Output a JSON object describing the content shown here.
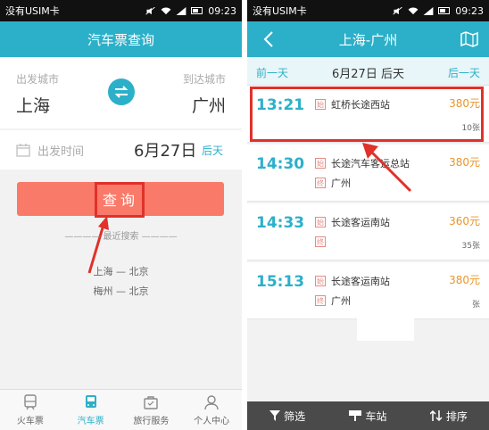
{
  "left": {
    "status": {
      "carrier": "没有USIM卡",
      "time": "09:23"
    },
    "title": "汽车票查询",
    "from_label": "出发城市",
    "to_label": "到达城市",
    "from_city": "上海",
    "to_city": "广州",
    "date_label": "出发时间",
    "date_value": "6月27日",
    "date_day": "后天",
    "query_button": "查询",
    "recent_title": "———— 最近搜索 ————",
    "recent": [
      "上海 — 北京",
      "梅州 — 北京"
    ],
    "tabs": [
      {
        "label": "火车票",
        "icon": "train-icon"
      },
      {
        "label": "汽车票",
        "icon": "bus-icon"
      },
      {
        "label": "旅行服务",
        "icon": "bag-icon"
      },
      {
        "label": "个人中心",
        "icon": "person-icon"
      }
    ],
    "accent": "#2cb0c9",
    "button_color": "#fa7a6a",
    "highlight_color": "#e0312a"
  },
  "right": {
    "status": {
      "carrier": "没有USIM卡",
      "time": "09:23"
    },
    "title": "上海-广州",
    "prev_day": "前一天",
    "current_day": "6月27日  后天",
    "next_day": "后一天",
    "start_tag": "始",
    "end_tag": "终",
    "trips": [
      {
        "time": "13:21",
        "from": "虹桥长途西站",
        "to": "",
        "price": "380元",
        "seats": "10张"
      },
      {
        "time": "14:30",
        "from": "长途汽车客运总站",
        "to": "广州",
        "price": "380元",
        "seats": ""
      },
      {
        "time": "14:33",
        "from": "长途客运南站",
        "to": "",
        "price": "360元",
        "seats": "35张"
      },
      {
        "time": "15:13",
        "from": "长途客运南站",
        "to": "广州",
        "price": "380元",
        "seats": "张"
      }
    ],
    "bottom_buttons": [
      {
        "label": "筛选",
        "icon": "filter-icon"
      },
      {
        "label": "车站",
        "icon": "station-icon"
      },
      {
        "label": "排序",
        "icon": "sort-icon"
      }
    ],
    "price_color": "#e8962a"
  }
}
